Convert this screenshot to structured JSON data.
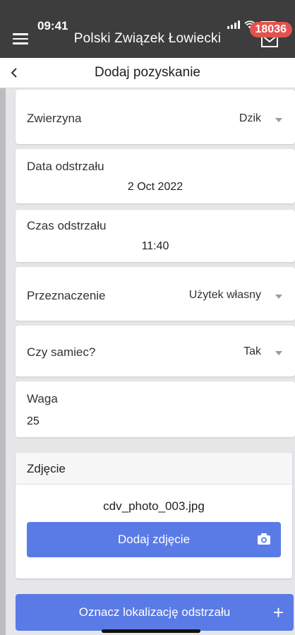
{
  "status": {
    "time": "09:41"
  },
  "header": {
    "title": "Polski Związek Łowiecki",
    "badge": "18036"
  },
  "subheader": {
    "title": "Dodaj pozyskanie"
  },
  "form": {
    "zwierzyna": {
      "label": "Zwierzyna",
      "value": "Dzik"
    },
    "data": {
      "label": "Data odstrzału",
      "value": "2 Oct 2022"
    },
    "czas": {
      "label": "Czas odstrzału",
      "value": "11:40"
    },
    "przeznaczenie": {
      "label": "Przeznaczenie",
      "value": "Użytek własny"
    },
    "samiec": {
      "label": "Czy samiec?",
      "value": "Tak"
    },
    "waga": {
      "label": "Waga",
      "value": "25"
    }
  },
  "photo": {
    "title": "Zdjęcie",
    "filename": "cdv_photo_003.jpg",
    "button_label": "Dodaj zdjęcie"
  },
  "location": {
    "button_label": "Oznacz lokalizację odstrzału"
  },
  "colors": {
    "primary": "#5a7be6",
    "header_bg": "#3d3d3d",
    "badge": "#e2534f"
  },
  "icons": [
    "menu-icon",
    "mail-icon",
    "back-icon",
    "chevron-down-icon",
    "camera-icon",
    "plus-icon"
  ]
}
